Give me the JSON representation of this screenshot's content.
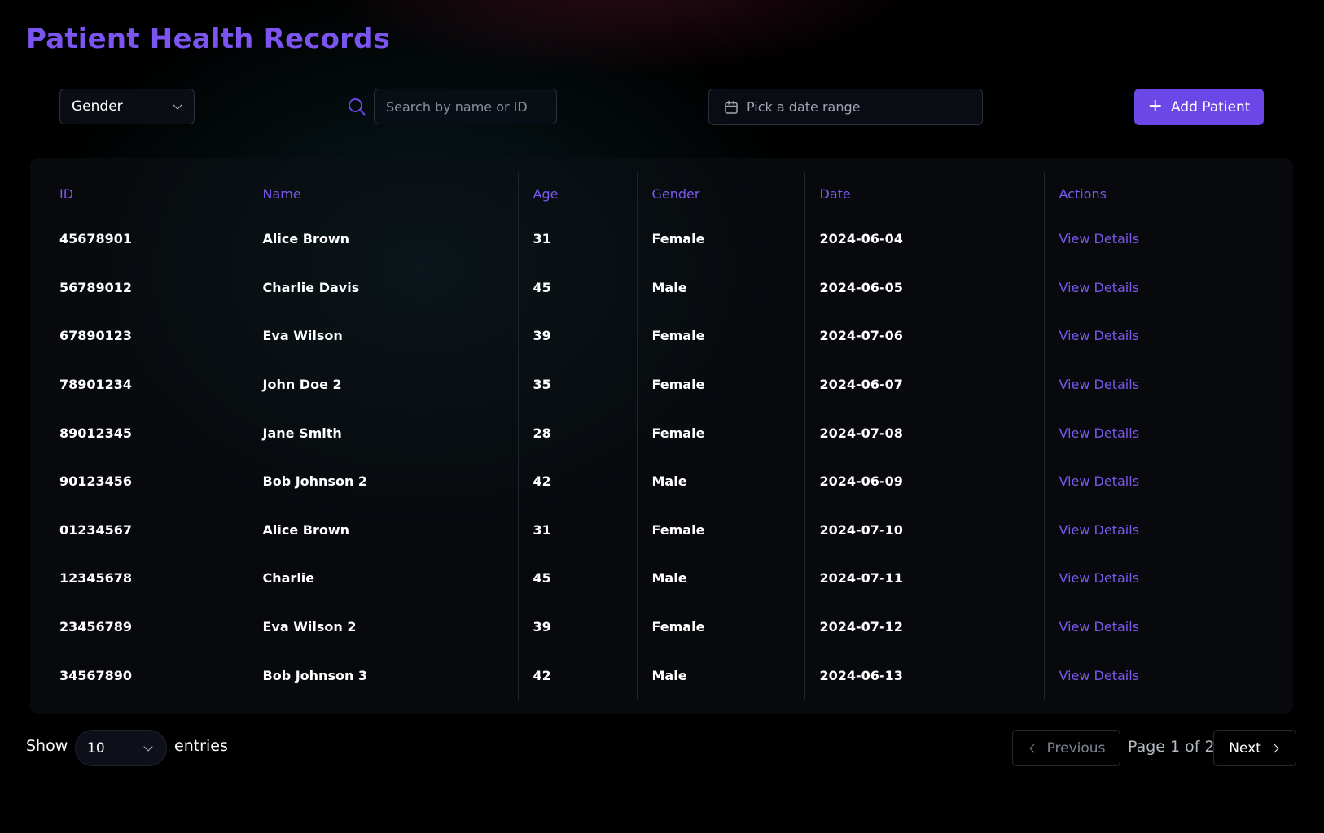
{
  "page": {
    "title": "Patient Health Records"
  },
  "toolbar": {
    "gender_filter": "Gender",
    "search_placeholder": "Search by name or ID",
    "date_placeholder": "Pick a date range",
    "add_button": "Add Patient"
  },
  "table": {
    "columns": [
      "ID",
      "Name",
      "Age",
      "Gender",
      "Date",
      "Actions"
    ],
    "rows": [
      {
        "id": "45678901",
        "name": "Alice Brown",
        "age": "31",
        "gender": "Female",
        "date": "2024-06-04",
        "action": "View Details"
      },
      {
        "id": "56789012",
        "name": "Charlie Davis",
        "age": "45",
        "gender": "Male",
        "date": "2024-06-05",
        "action": "View Details"
      },
      {
        "id": "67890123",
        "name": "Eva Wilson",
        "age": "39",
        "gender": "Female",
        "date": "2024-07-06",
        "action": "View Details"
      },
      {
        "id": "78901234",
        "name": "John Doe 2",
        "age": "35",
        "gender": "Female",
        "date": "2024-06-07",
        "action": "View Details"
      },
      {
        "id": "89012345",
        "name": "Jane Smith",
        "age": "28",
        "gender": "Female",
        "date": "2024-07-08",
        "action": "View Details"
      },
      {
        "id": "90123456",
        "name": "Bob Johnson 2",
        "age": "42",
        "gender": "Male",
        "date": "2024-06-09",
        "action": "View Details"
      },
      {
        "id": "01234567",
        "name": "Alice Brown",
        "age": "31",
        "gender": "Female",
        "date": "2024-07-10",
        "action": "View Details"
      },
      {
        "id": "12345678",
        "name": "Charlie",
        "age": "45",
        "gender": "Male",
        "date": "2024-07-11",
        "action": "View Details"
      },
      {
        "id": "23456789",
        "name": "Eva Wilson 2",
        "age": "39",
        "gender": "Female",
        "date": "2024-07-12",
        "action": "View Details"
      },
      {
        "id": "34567890",
        "name": "Bob Johnson 3",
        "age": "42",
        "gender": "Male",
        "date": "2024-06-13",
        "action": "View Details"
      }
    ]
  },
  "footer": {
    "show_label": "Show",
    "entries_value": "10",
    "entries_label": "entries",
    "prev_label": "Previous",
    "page_info": "Page 1 of 2",
    "next_label": "Next"
  },
  "icons": {
    "gender_chevron": "chevron-down-icon",
    "search": "search-icon",
    "calendar": "calendar-icon",
    "add": "plus-icon",
    "entries_chevron": "chevron-down-icon",
    "prev": "chevron-left-icon",
    "next": "chevron-right-icon"
  },
  "colors": {
    "accent": "#6a47e6",
    "accent_text": "#7b58ea",
    "background": "#000000",
    "text": "#ffffff"
  }
}
